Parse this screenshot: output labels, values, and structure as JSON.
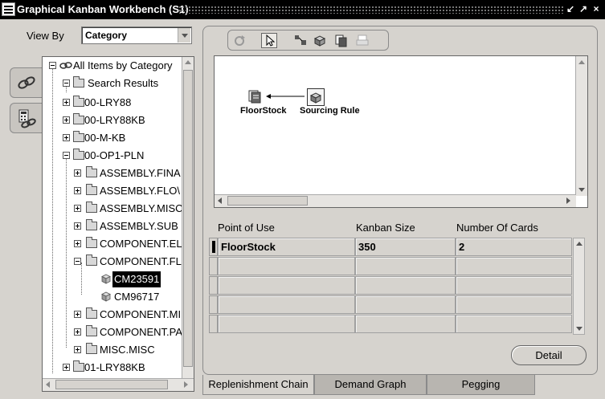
{
  "window": {
    "title": "Graphical Kanban Workbench (S1)"
  },
  "left_panel": {
    "view_by_label": "View By",
    "view_by_value": "Category",
    "tree": [
      "All Items by Category",
      "Search Results",
      "00-LRY88",
      "00-LRY88KB",
      "00-M-KB",
      "00-OP1-PLN",
      "ASSEMBLY.FINA",
      "ASSEMBLY.FLO\\",
      "ASSEMBLY.MISC",
      "ASSEMBLY.SUB",
      "COMPONENT.EL",
      "COMPONENT.FL",
      "CM23591",
      "CM96717",
      "COMPONENT.MI",
      "COMPONENT.PA",
      "MISC.MISC",
      "01-LRY88KB"
    ]
  },
  "diagram": {
    "nodes": [
      {
        "label": "FloorStock",
        "icon": "floorstock-icon"
      },
      {
        "label": "Sourcing Rule",
        "icon": "sourcing-rule-icon"
      }
    ]
  },
  "table": {
    "columns": [
      "Point of Use",
      "Kanban Size",
      "Number Of Cards"
    ],
    "rows": [
      [
        "FloorStock",
        "350",
        "2"
      ],
      [
        "",
        "",
        ""
      ],
      [
        "",
        "",
        ""
      ],
      [
        "",
        "",
        ""
      ],
      [
        "",
        "",
        ""
      ]
    ]
  },
  "detail_button": "Detail",
  "tabs": [
    "Replenishment Chain",
    "Demand Graph",
    "Pegging"
  ],
  "active_tab": 0
}
